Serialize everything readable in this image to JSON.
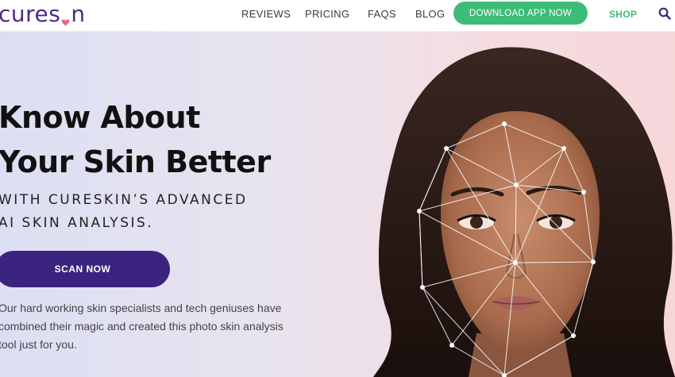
{
  "nav": {
    "logo_before": "cures",
    "logo_after": "n",
    "links": [
      "REVIEWS",
      "PRICING",
      "FAQS",
      "BLOG"
    ],
    "download_label": "DOWNLOAD APP NOW",
    "shop_label": "SHOP",
    "search_icon": "search-icon"
  },
  "hero": {
    "title_line1": "Know About",
    "title_line2": "Your Skin Better",
    "subtitle_line1": "WITH CURESKIN’S ADVANCED",
    "subtitle_line2": "AI SKIN ANALYSIS.",
    "cta_label": "SCAN NOW",
    "desc_line1": "Our hard working skin specialists and tech geniuses have",
    "desc_line2": "combined their magic and created this photo skin analysis",
    "desc_line3": "tool just for you."
  },
  "colors": {
    "brand_purple": "#4b2a86",
    "cta_purple": "#3b2480",
    "green": "#3cbc78"
  }
}
